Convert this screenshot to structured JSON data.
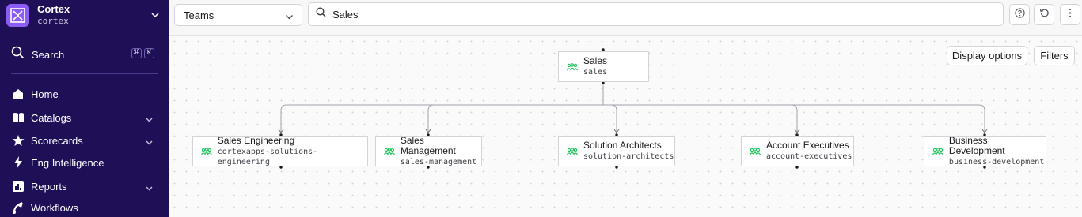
{
  "workspace": {
    "name": "Cortex",
    "slug": "cortex"
  },
  "sidebar": {
    "search_label": "Search",
    "shortcut": [
      "⌘",
      "K"
    ],
    "items": [
      {
        "label": "Home",
        "icon": "home-icon",
        "has_children": false
      },
      {
        "label": "Catalogs",
        "icon": "book-icon",
        "has_children": true
      },
      {
        "label": "Scorecards",
        "icon": "star-icon",
        "has_children": true
      },
      {
        "label": "Eng Intelligence",
        "icon": "bolt-icon",
        "has_children": false
      },
      {
        "label": "Reports",
        "icon": "report-icon",
        "has_children": true
      },
      {
        "label": "Workflows",
        "icon": "workflow-icon",
        "has_children": false
      }
    ]
  },
  "topbar": {
    "entity_type": "Teams",
    "search_value": "Sales",
    "help_icon": "question-icon",
    "reset_icon": "reset-icon",
    "more_icon": "more-vertical-icon"
  },
  "canvas": {
    "display_options_label": "Display options",
    "filters_label": "Filters",
    "root": {
      "title": "Sales",
      "slug": "sales"
    },
    "children": [
      {
        "title": "Sales Engineering",
        "slug": "cortexapps-solutions-engineering"
      },
      {
        "title": "Sales Management",
        "slug": "sales-management"
      },
      {
        "title": "Solution Architects",
        "slug": "solution-architects"
      },
      {
        "title": "Account Executives",
        "slug": "account-executives"
      },
      {
        "title": "Business Development",
        "slug": "business-development"
      }
    ]
  },
  "colors": {
    "sidebar": "#1f0f57",
    "logo": "#8b5cf6",
    "team_icon": "#22c55e"
  }
}
